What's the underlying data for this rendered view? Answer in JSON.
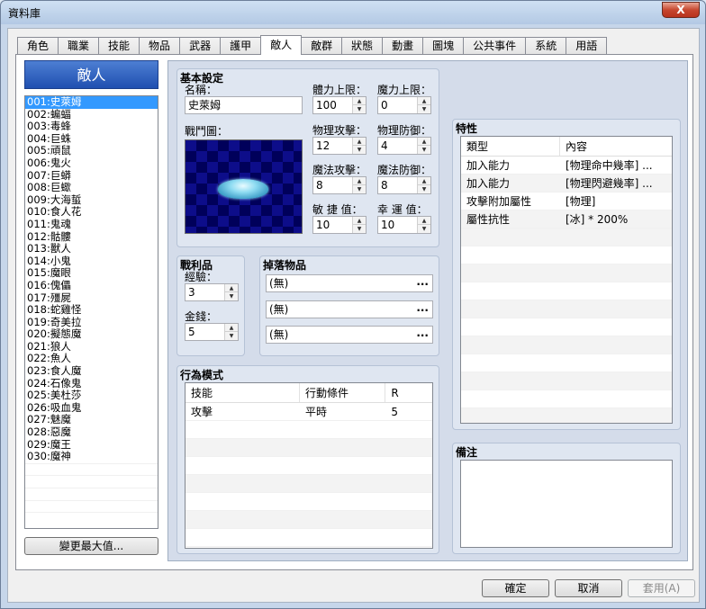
{
  "window": {
    "title": "資料庫",
    "close_label": "X"
  },
  "tabs": [
    "角色",
    "職業",
    "技能",
    "物品",
    "武器",
    "護甲",
    "敵人",
    "敵群",
    "狀態",
    "動畫",
    "圖塊",
    "公共事件",
    "系統",
    "用語"
  ],
  "active_tab": "敵人",
  "list": {
    "title": "敵人",
    "items": [
      "001:史萊姆",
      "002:蝙蝠",
      "003:毒蜂",
      "004:巨蛛",
      "005:頑鼠",
      "006:鬼火",
      "007:巨蟒",
      "008:巨蠍",
      "009:大海蜇",
      "010:食人花",
      "011:鬼魂",
      "012:骷髏",
      "013:獸人",
      "014:小鬼",
      "015:魔眼",
      "016:傀儡",
      "017:殭屍",
      "018:蛇雞怪",
      "019:奇美拉",
      "020:擬態魔",
      "021:狼人",
      "022:魚人",
      "023:食人魔",
      "024:石像鬼",
      "025:美杜莎",
      "026:吸血鬼",
      "027:魅魔",
      "028:惡魔",
      "029:魔王",
      "030:魔神"
    ],
    "selected_index": 0,
    "change_max_label": "變更最大值..."
  },
  "basic": {
    "title": "基本設定",
    "name_label": "名稱：",
    "name_value": "史萊姆",
    "battler_label": "戰鬥圖：",
    "maxhp_label": "體力上限：",
    "maxhp": "100",
    "maxmp_label": "魔力上限：",
    "maxmp": "0",
    "atk_label": "物理攻擊：",
    "atk": "12",
    "def_label": "物理防御：",
    "def": "4",
    "mat_label": "魔法攻擊：",
    "mat": "8",
    "mdf_label": "魔法防御：",
    "mdf": "8",
    "agi_label": "敏 捷 值：",
    "agi": "10",
    "luk_label": "幸 運 值：",
    "luk": "10"
  },
  "spoils": {
    "title": "戰利品",
    "exp_label": "經驗：",
    "exp": "3",
    "gold_label": "金錢：",
    "gold": "5"
  },
  "drops": {
    "title": "掉落物品",
    "items": [
      "(無)",
      "(無)",
      "(無)"
    ],
    "more": "..."
  },
  "actions": {
    "title": "行為模式",
    "headers": [
      "技能",
      "行動條件",
      "R"
    ],
    "rows": [
      [
        "攻擊",
        "平時",
        "5"
      ]
    ]
  },
  "traits": {
    "title": "特性",
    "headers": [
      "類型",
      "內容"
    ],
    "rows": [
      [
        "加入能力",
        "[物理命中幾率] ..."
      ],
      [
        "加入能力",
        "[物理閃避幾率] ..."
      ],
      [
        "攻擊附加屬性",
        "[物理]"
      ],
      [
        "屬性抗性",
        "[冰] * 200%"
      ]
    ]
  },
  "notes": {
    "title": "備注"
  },
  "footer": {
    "ok": "確定",
    "cancel": "取消",
    "apply": "套用(A)"
  }
}
